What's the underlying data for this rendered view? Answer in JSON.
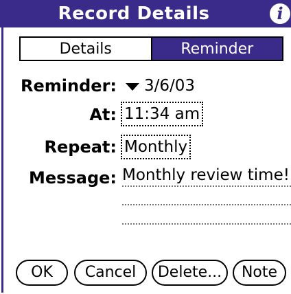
{
  "titlebar": {
    "title": "Record Details",
    "info_icon": "info-icon"
  },
  "tabs": [
    {
      "label": "Details",
      "selected": false
    },
    {
      "label": "Reminder",
      "selected": true
    }
  ],
  "form": {
    "reminder_label": "Reminder:",
    "reminder_value": "3/6/03",
    "at_label": "At:",
    "at_value": "11:34 am",
    "repeat_label": "Repeat:",
    "repeat_value": "Monthly",
    "message_label": "Message:",
    "message_value": "Monthly review time!"
  },
  "buttons": {
    "ok": "OK",
    "cancel": "Cancel",
    "delete": "Delete...",
    "note": "Note"
  },
  "colors": {
    "accent": "#3a2a8a",
    "background": "#ffffff"
  }
}
